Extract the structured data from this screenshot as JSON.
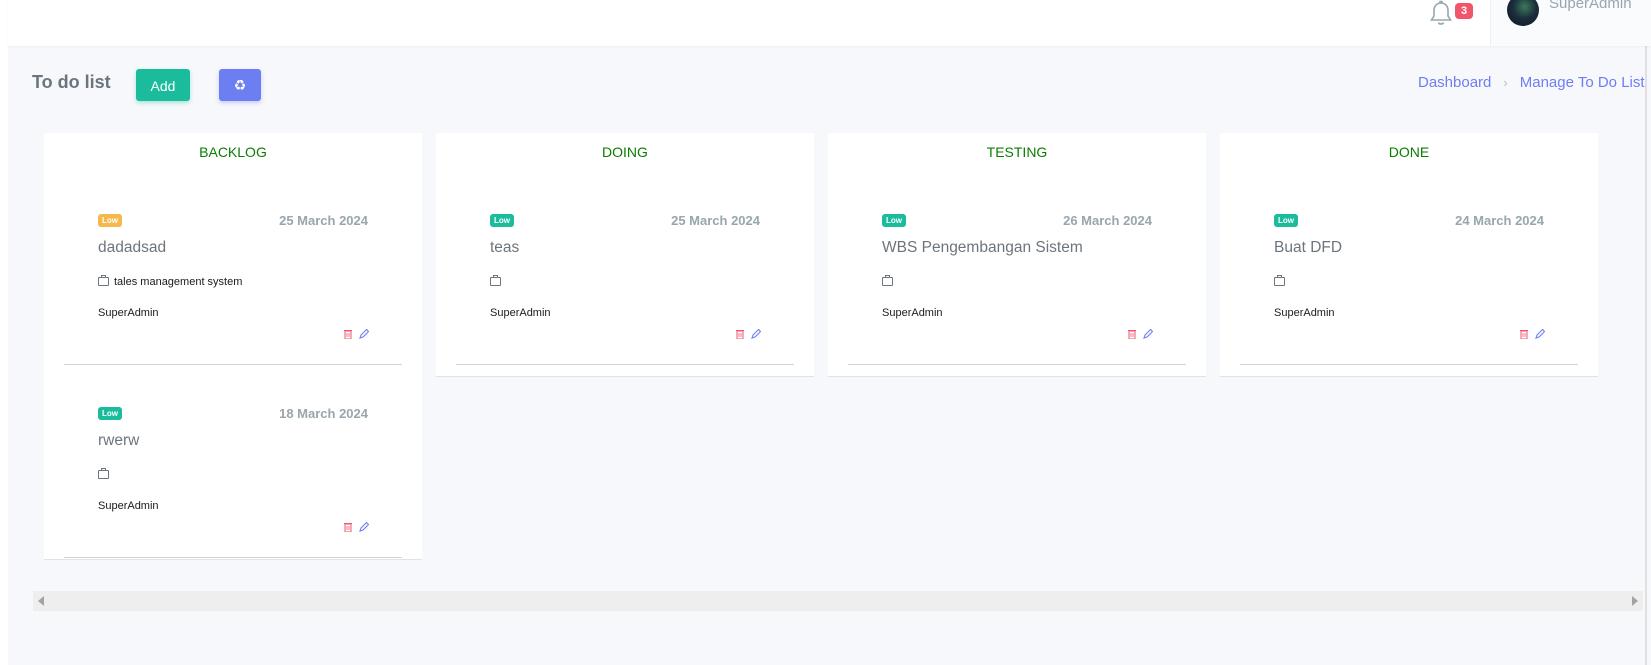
{
  "topbar": {
    "notification_icon": "bell-icon",
    "notification_count": "3",
    "user_name": "SuperAdmin",
    "avatar_icon": "user-avatar"
  },
  "page": {
    "title": "To do list",
    "add_label": "Add",
    "recycle_icon": "recycle-icon",
    "recycle_glyph": "♻"
  },
  "breadcrumb": {
    "items": [
      "Dashboard",
      "Manage To Do List"
    ],
    "separator": "›"
  },
  "colors": {
    "accent": "#6c7ef2",
    "success": "#1abc9c",
    "column_title": "#0a7d00",
    "badge_low_yellow": "#f7b84b",
    "badge_low_green": "#1abc9c",
    "danger": "#f1556c"
  },
  "columns": [
    {
      "title": "BACKLOG",
      "tasks": [
        {
          "priority": "Low",
          "priority_color": "#f7b84b",
          "date": "25 March 2024",
          "title": "dadadsad",
          "project": "tales management system",
          "owner": "SuperAdmin"
        },
        {
          "priority": "Low",
          "priority_color": "#1abc9c",
          "date": "18 March 2024",
          "title": "rwerw",
          "project": "",
          "owner": "SuperAdmin"
        }
      ]
    },
    {
      "title": "DOING",
      "tasks": [
        {
          "priority": "Low",
          "priority_color": "#1abc9c",
          "date": "25 March 2024",
          "title": "teas",
          "project": "",
          "owner": "SuperAdmin"
        }
      ]
    },
    {
      "title": "TESTING",
      "tasks": [
        {
          "priority": "Low",
          "priority_color": "#1abc9c",
          "date": "26 March 2024",
          "title": "WBS Pengembangan Sistem",
          "project": "",
          "owner": "SuperAdmin"
        }
      ]
    },
    {
      "title": "DONE",
      "tasks": [
        {
          "priority": "Low",
          "priority_color": "#1abc9c",
          "date": "24 March 2024",
          "title": "Buat DFD",
          "project": "",
          "owner": "SuperAdmin"
        }
      ]
    }
  ]
}
